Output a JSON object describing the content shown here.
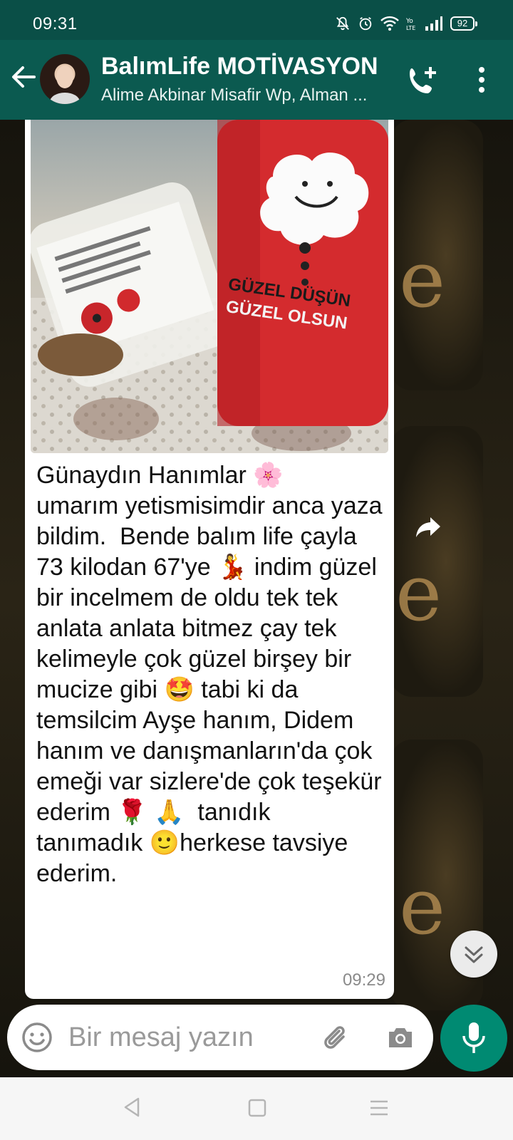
{
  "status_bar": {
    "time": "09:31",
    "battery": "92",
    "icons": [
      "mute-icon",
      "alarm-icon",
      "wifi-icon",
      "volte-icon",
      "signal-icon",
      "battery-icon"
    ]
  },
  "header": {
    "title": "BalımLife MOTİVASYON",
    "subtitle": "Alime Akbinar Misafir Wp, Alman ..."
  },
  "message": {
    "text": "Günaydın Hanımlar 🌸\numarım yetismisimdir anca yaza bildim.  Bende balım life çayla 73 kilodan 67'ye 💃 indim güzel bir incelmem de oldu tek tek anlata anlata bitmez çay tek kelimeyle çok güzel birşey bir mucize gibi 🤩 tabi ki da temsilcim Ayşe hanım, Didem hanım ve danışmanların'da çok emeği var sizlere'de çok teşekür ederim 🌹 🙏  tanıdık tanımadık 🙂herkese tavsiye ederim.",
    "time": "09:29",
    "photo": {
      "label_line1": "GÜZEL DÜŞÜN",
      "label_line2": "GÜZEL OLSUN"
    }
  },
  "composer": {
    "placeholder": "Bir mesaj yazın"
  },
  "colors": {
    "header": "#0b5a50",
    "status_bar": "#0a4f47",
    "accent": "#008a72",
    "bubble": "#ffffff"
  }
}
